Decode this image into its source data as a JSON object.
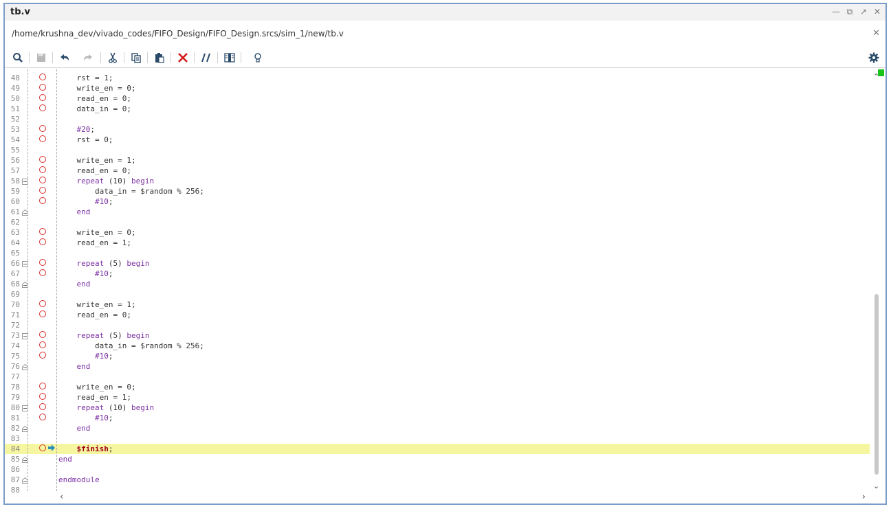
{
  "window": {
    "title": "tb.v",
    "file_path": "/home/krushna_dev/vivado_codes/FIFO_Design/FIFO_Design.srcs/sim_1/new/tb.v"
  },
  "toolbar": [
    "search-icon",
    "save-icon",
    "undo-icon",
    "redo-icon",
    "cut-icon",
    "copy-icon",
    "paste-icon",
    "delete-icon",
    "comment-icon",
    "column-icon",
    "hint-icon"
  ],
  "lines": [
    {
      "n": "48",
      "bp": true,
      "fold": "",
      "segs": [
        [
          "    rst = 1;",
          ""
        ]
      ]
    },
    {
      "n": "49",
      "bp": true,
      "fold": "",
      "segs": [
        [
          "    write_en = 0;",
          ""
        ]
      ]
    },
    {
      "n": "50",
      "bp": true,
      "fold": "",
      "segs": [
        [
          "    read_en = 0;",
          ""
        ]
      ]
    },
    {
      "n": "51",
      "bp": true,
      "fold": "",
      "segs": [
        [
          "    data_in = 0;",
          ""
        ]
      ]
    },
    {
      "n": "52",
      "bp": false,
      "fold": "",
      "segs": []
    },
    {
      "n": "53",
      "bp": true,
      "fold": "",
      "segs": [
        [
          "    ",
          ""
        ],
        [
          "#20",
          "kw"
        ],
        [
          ";",
          ""
        ]
      ]
    },
    {
      "n": "54",
      "bp": true,
      "fold": "",
      "segs": [
        [
          "    rst = 0;",
          ""
        ]
      ]
    },
    {
      "n": "55",
      "bp": false,
      "fold": "",
      "segs": []
    },
    {
      "n": "56",
      "bp": true,
      "fold": "",
      "segs": [
        [
          "    write_en = 1;",
          ""
        ]
      ]
    },
    {
      "n": "57",
      "bp": true,
      "fold": "",
      "segs": [
        [
          "    read_en = 0;",
          ""
        ]
      ]
    },
    {
      "n": "58",
      "bp": true,
      "fold": "open",
      "segs": [
        [
          "    ",
          ""
        ],
        [
          "repeat",
          "kw"
        ],
        [
          " (10) ",
          ""
        ],
        [
          "begin",
          "kw"
        ]
      ]
    },
    {
      "n": "59",
      "bp": true,
      "fold": "",
      "segs": [
        [
          "        data_in = $random % 256;",
          ""
        ]
      ]
    },
    {
      "n": "60",
      "bp": true,
      "fold": "",
      "segs": [
        [
          "        ",
          ""
        ],
        [
          "#10",
          "kw"
        ],
        [
          ";",
          ""
        ]
      ]
    },
    {
      "n": "61",
      "bp": false,
      "fold": "close",
      "segs": [
        [
          "    ",
          ""
        ],
        [
          "end",
          "kw"
        ]
      ]
    },
    {
      "n": "62",
      "bp": false,
      "fold": "",
      "segs": []
    },
    {
      "n": "63",
      "bp": true,
      "fold": "",
      "segs": [
        [
          "    write_en = 0;",
          ""
        ]
      ]
    },
    {
      "n": "64",
      "bp": true,
      "fold": "",
      "segs": [
        [
          "    read_en = 1;",
          ""
        ]
      ]
    },
    {
      "n": "65",
      "bp": false,
      "fold": "",
      "segs": []
    },
    {
      "n": "66",
      "bp": true,
      "fold": "open",
      "segs": [
        [
          "    ",
          ""
        ],
        [
          "repeat",
          "kw"
        ],
        [
          " (5) ",
          ""
        ],
        [
          "begin",
          "kw"
        ]
      ]
    },
    {
      "n": "67",
      "bp": true,
      "fold": "",
      "segs": [
        [
          "        ",
          ""
        ],
        [
          "#10",
          "kw"
        ],
        [
          ";",
          ""
        ]
      ]
    },
    {
      "n": "68",
      "bp": false,
      "fold": "close",
      "segs": [
        [
          "    ",
          ""
        ],
        [
          "end",
          "kw"
        ]
      ]
    },
    {
      "n": "69",
      "bp": false,
      "fold": "",
      "segs": []
    },
    {
      "n": "70",
      "bp": true,
      "fold": "",
      "segs": [
        [
          "    write_en = 1;",
          ""
        ]
      ]
    },
    {
      "n": "71",
      "bp": true,
      "fold": "",
      "segs": [
        [
          "    read_en = 0;",
          ""
        ]
      ]
    },
    {
      "n": "72",
      "bp": false,
      "fold": "",
      "segs": []
    },
    {
      "n": "73",
      "bp": true,
      "fold": "open",
      "segs": [
        [
          "    ",
          ""
        ],
        [
          "repeat",
          "kw"
        ],
        [
          " (5) ",
          ""
        ],
        [
          "begin",
          "kw"
        ]
      ]
    },
    {
      "n": "74",
      "bp": true,
      "fold": "",
      "segs": [
        [
          "        data_in = $random % 256;",
          ""
        ]
      ]
    },
    {
      "n": "75",
      "bp": true,
      "fold": "",
      "segs": [
        [
          "        ",
          ""
        ],
        [
          "#10",
          "kw"
        ],
        [
          ";",
          ""
        ]
      ]
    },
    {
      "n": "76",
      "bp": false,
      "fold": "close",
      "segs": [
        [
          "    ",
          ""
        ],
        [
          "end",
          "kw"
        ]
      ]
    },
    {
      "n": "77",
      "bp": false,
      "fold": "",
      "segs": []
    },
    {
      "n": "78",
      "bp": true,
      "fold": "",
      "segs": [
        [
          "    write_en = 0;",
          ""
        ]
      ]
    },
    {
      "n": "79",
      "bp": true,
      "fold": "",
      "segs": [
        [
          "    read_en = 1;",
          ""
        ]
      ]
    },
    {
      "n": "80",
      "bp": true,
      "fold": "open",
      "segs": [
        [
          "    ",
          ""
        ],
        [
          "repeat",
          "kw"
        ],
        [
          " (10) ",
          ""
        ],
        [
          "begin",
          "kw"
        ]
      ]
    },
    {
      "n": "81",
      "bp": true,
      "fold": "",
      "segs": [
        [
          "        ",
          ""
        ],
        [
          "#10",
          "kw"
        ],
        [
          ";",
          ""
        ]
      ]
    },
    {
      "n": "82",
      "bp": false,
      "fold": "close",
      "segs": [
        [
          "    ",
          ""
        ],
        [
          "end",
          "kw"
        ]
      ]
    },
    {
      "n": "83",
      "bp": false,
      "fold": "",
      "segs": []
    },
    {
      "n": "84",
      "bp": true,
      "arrow": true,
      "hl": true,
      "fold": "",
      "segs": [
        [
          "    ",
          ""
        ],
        [
          "$finish",
          "sysfinish"
        ],
        [
          ";",
          ""
        ]
      ]
    },
    {
      "n": "85",
      "bp": false,
      "fold": "close",
      "segs": [
        [
          "end",
          "kw"
        ]
      ]
    },
    {
      "n": "86",
      "bp": false,
      "fold": "",
      "segs": []
    },
    {
      "n": "87",
      "bp": false,
      "fold": "close",
      "segs": [
        [
          "endmodule",
          "kw"
        ]
      ]
    },
    {
      "n": "88",
      "bp": false,
      "fold": "",
      "segs": []
    }
  ]
}
